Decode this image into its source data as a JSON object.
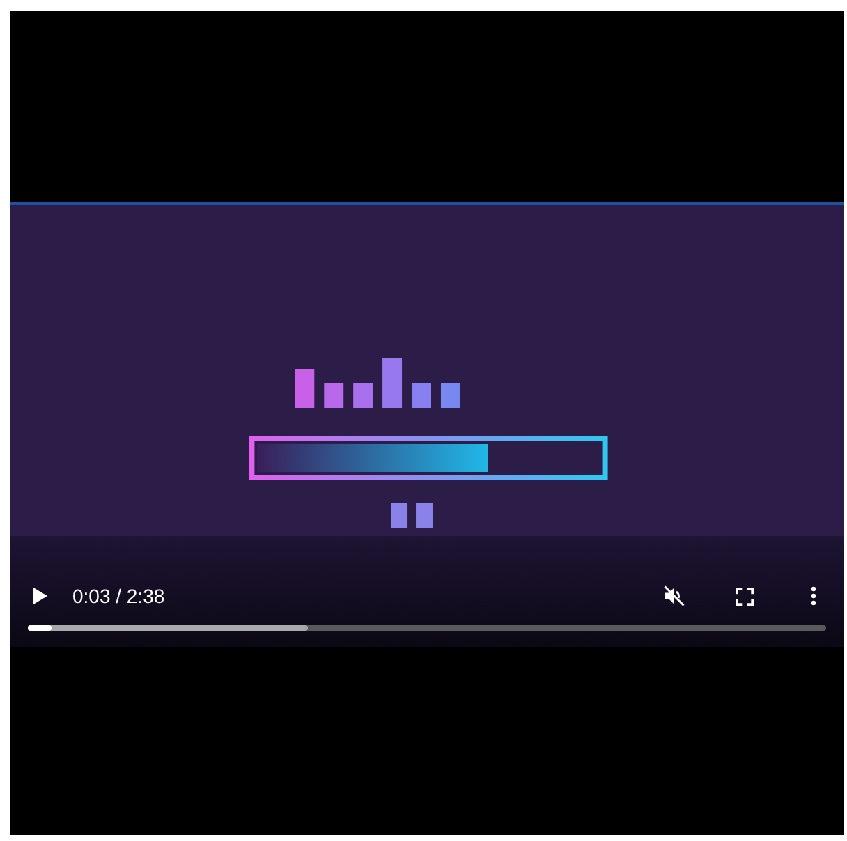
{
  "controls": {
    "playing": false,
    "time": "0:03 / 2:38",
    "muted": true,
    "progress": {
      "level": 0.03
    },
    "buffer": {
      "level": 0.35
    }
  }
}
